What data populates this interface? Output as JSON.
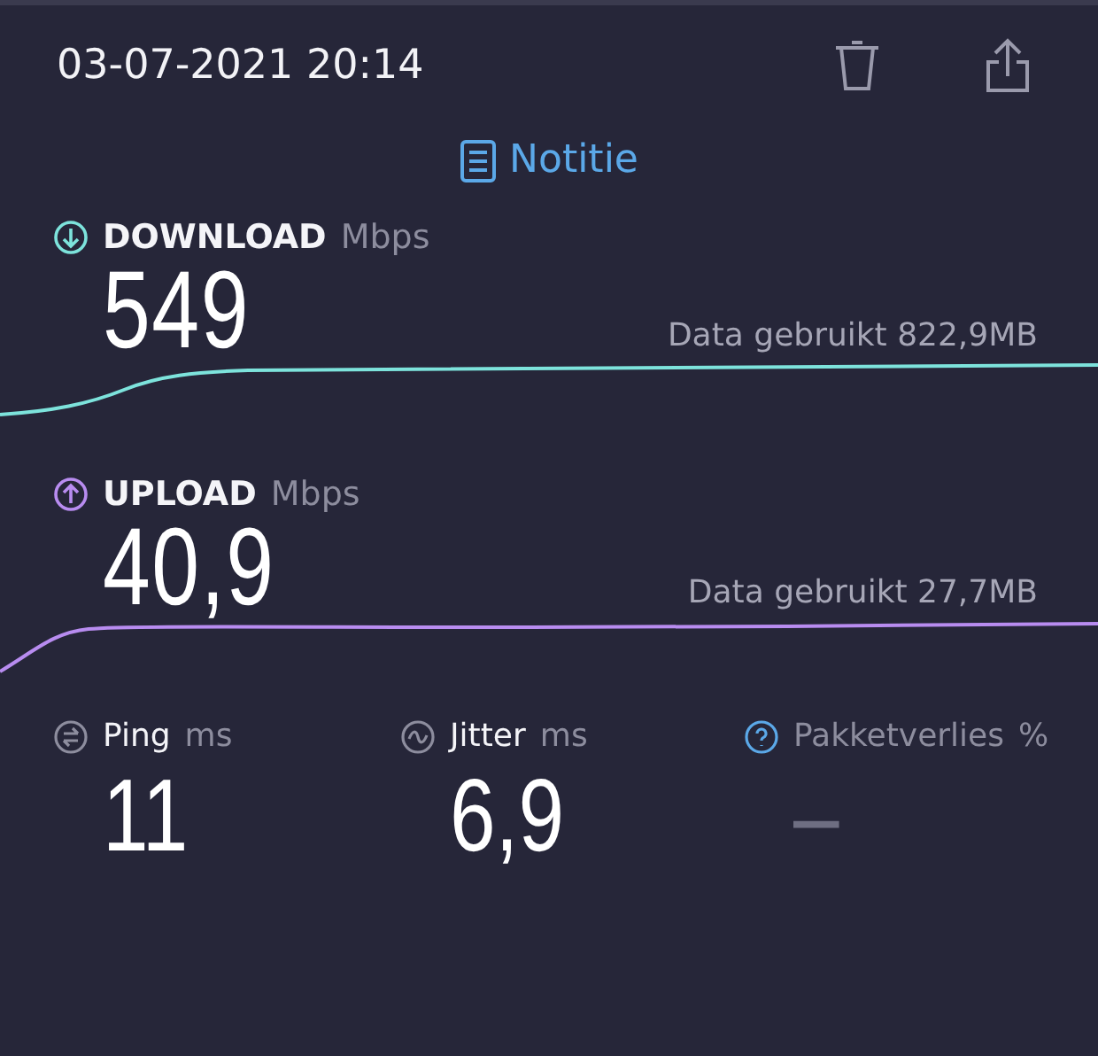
{
  "header": {
    "datetime": "03-07-2021 20:14"
  },
  "note_link": {
    "label": "Notitie"
  },
  "speeds": [
    {
      "kind": "download",
      "label": "DOWNLOAD",
      "unit": "Mbps",
      "value": "549",
      "data_used": "Data gebruikt 822,9MB",
      "color": "#7de3dc"
    },
    {
      "kind": "upload",
      "label": "UPLOAD",
      "unit": "Mbps",
      "value": "40,9",
      "data_used": "Data gebruikt 27,7MB",
      "color": "#b88cf0"
    }
  ],
  "metrics": [
    {
      "kind": "ping",
      "label": "Ping",
      "unit": "ms",
      "value": "11",
      "disabled": false
    },
    {
      "kind": "jitter",
      "label": "Jitter",
      "unit": "ms",
      "value": "6,9",
      "disabled": false
    },
    {
      "kind": "loss",
      "label": "Pakketverlies",
      "unit": "%",
      "value": "–",
      "disabled": true
    }
  ]
}
